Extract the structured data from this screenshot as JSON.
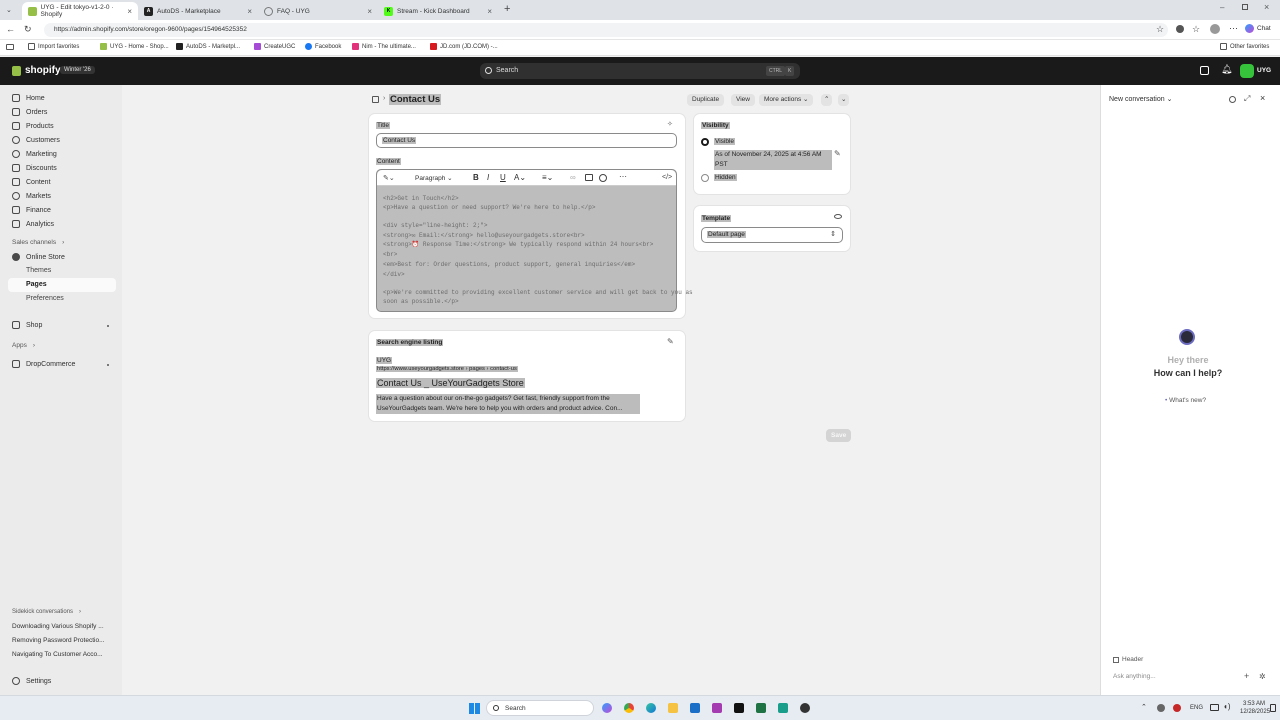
{
  "browser": {
    "tabs": [
      {
        "title": "UYG - Edit tokyo-v1-2-0 · Shopify",
        "active": true
      },
      {
        "title": "AutoDS - Marketplace",
        "active": false
      },
      {
        "title": "FAQ - UYG",
        "active": false
      },
      {
        "title": "Stream - Kick Dashboard",
        "active": false
      }
    ],
    "url": "https://admin.shopify.com/store/oregon-9600/pages/154964525352",
    "chat_label": "Chat",
    "favorites": [
      "Import favorites",
      "UYG - Home - Shop...",
      "AutoDS - Marketpl...",
      "CreateUGC",
      "Facebook",
      "Nim - The ultimate...",
      "JD.com (JD.COM) -..."
    ],
    "other_favorites": "Other favorites"
  },
  "shopify": {
    "logo": "shopify",
    "edition": "Winter '26",
    "search_placeholder": "Search",
    "search_kbd": [
      "CTRL",
      "K"
    ],
    "store_initials": "UYG"
  },
  "sidebar": {
    "items": [
      "Home",
      "Orders",
      "Products",
      "Customers",
      "Marketing",
      "Discounts",
      "Content",
      "Markets",
      "Finance",
      "Analytics"
    ],
    "sales_channels": "Sales channels",
    "online_store": "Online Store",
    "online_store_sub": [
      "Themes",
      "Pages",
      "Preferences"
    ],
    "shop": "Shop",
    "apps": "Apps",
    "dropcommerce": "DropCommerce",
    "sidekick_header": "Sidekick conversations",
    "conversations": [
      "Downloading Various Shopify ...",
      "Removing Password Protectio...",
      "Navigating To Customer Acco..."
    ],
    "settings": "Settings"
  },
  "page": {
    "title": "Contact Us",
    "actions": {
      "duplicate": "Duplicate",
      "view": "View",
      "more": "More actions"
    },
    "title_label": "Title",
    "title_value": "Contact Us",
    "content_label": "Content",
    "paragraph_select": "Paragraph",
    "code_lines": [
      "<h2>Get in Touch</h2>",
      "<p>Have a question or need support? We're here to help.</p>",
      "",
      "<div style=\"line-height: 2;\">",
      "  <strong>✉ Email:</strong> hello@useyourgadgets.store<br>",
      "  <strong>⏰ Response Time:</strong> We typically respond within 24 hours<br>",
      "  <br>",
      "  <em>Best for: Order questions, product support, general inquiries</em>",
      "</div>",
      "",
      "<p>We're committed to providing excellent customer service and will get back to you as",
      "soon as possible.</p>"
    ],
    "seo": {
      "heading": "Search engine listing",
      "store": "UYG",
      "url": "https://www.useyourgadgets.store › pages › contact-us",
      "title": "Contact Us _ UseYourGadgets Store",
      "description": "Have a question about our on-the-go gadgets? Get fast, friendly support from the UseYourGadgets team. We're here to help you with orders and product advice. Con..."
    },
    "visibility": {
      "label": "Visibility",
      "visible": "Visible",
      "visible_note": "As of November 24, 2025 at 4:56 AM PST",
      "hidden": "Hidden"
    },
    "template": {
      "label": "Template",
      "value": "Default page"
    },
    "save": "Save"
  },
  "sidekick": {
    "title": "New conversation",
    "greeting": "Hey there",
    "prompt": "How can I help?",
    "whats_new": "What's new?",
    "header_chip": "Header",
    "input_placeholder": "Ask anything..."
  },
  "taskbar": {
    "search": "Search",
    "lang": "ENG",
    "time": "3:53 AM",
    "date": "12/28/2025"
  },
  "colors": {
    "accent": "#95bf47",
    "topbar": "#1a1a1a",
    "avatar": "#36c23b"
  }
}
